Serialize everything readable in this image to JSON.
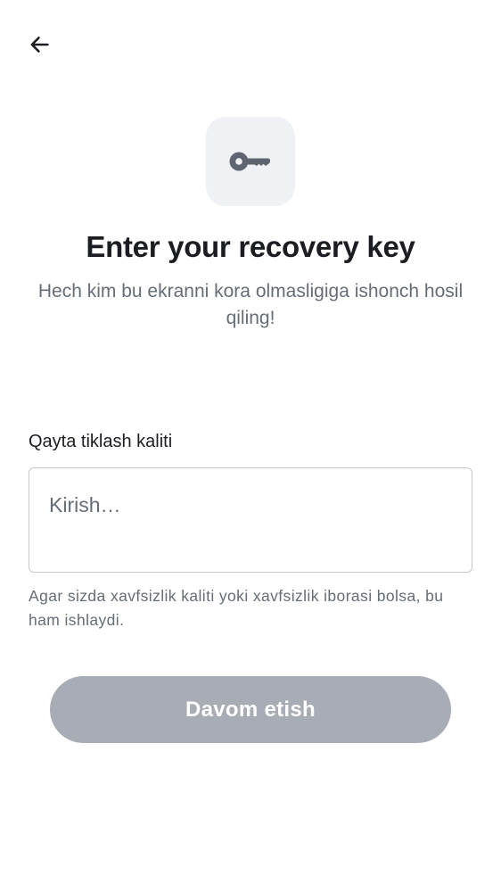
{
  "header": {
    "back_icon": "arrow-left-icon"
  },
  "hero": {
    "icon": "key-icon",
    "tile_color": "#f0f1f5",
    "title": "Enter your recovery key",
    "subtitle": "Hech kim bu ekranni kora olmasligiga ishonch hosil qiling!"
  },
  "form": {
    "label": "Qayta tiklash kaliti",
    "input_value": "",
    "input_placeholder": "Kirish…",
    "help_text": "Agar sizda xavfsizlik kaliti yoki xavfsizlik iborasi bolsa, bu ham ishlaydi."
  },
  "actions": {
    "continue_label": "Davom etish",
    "continue_enabled": false,
    "continue_color": "#a7acb5"
  }
}
